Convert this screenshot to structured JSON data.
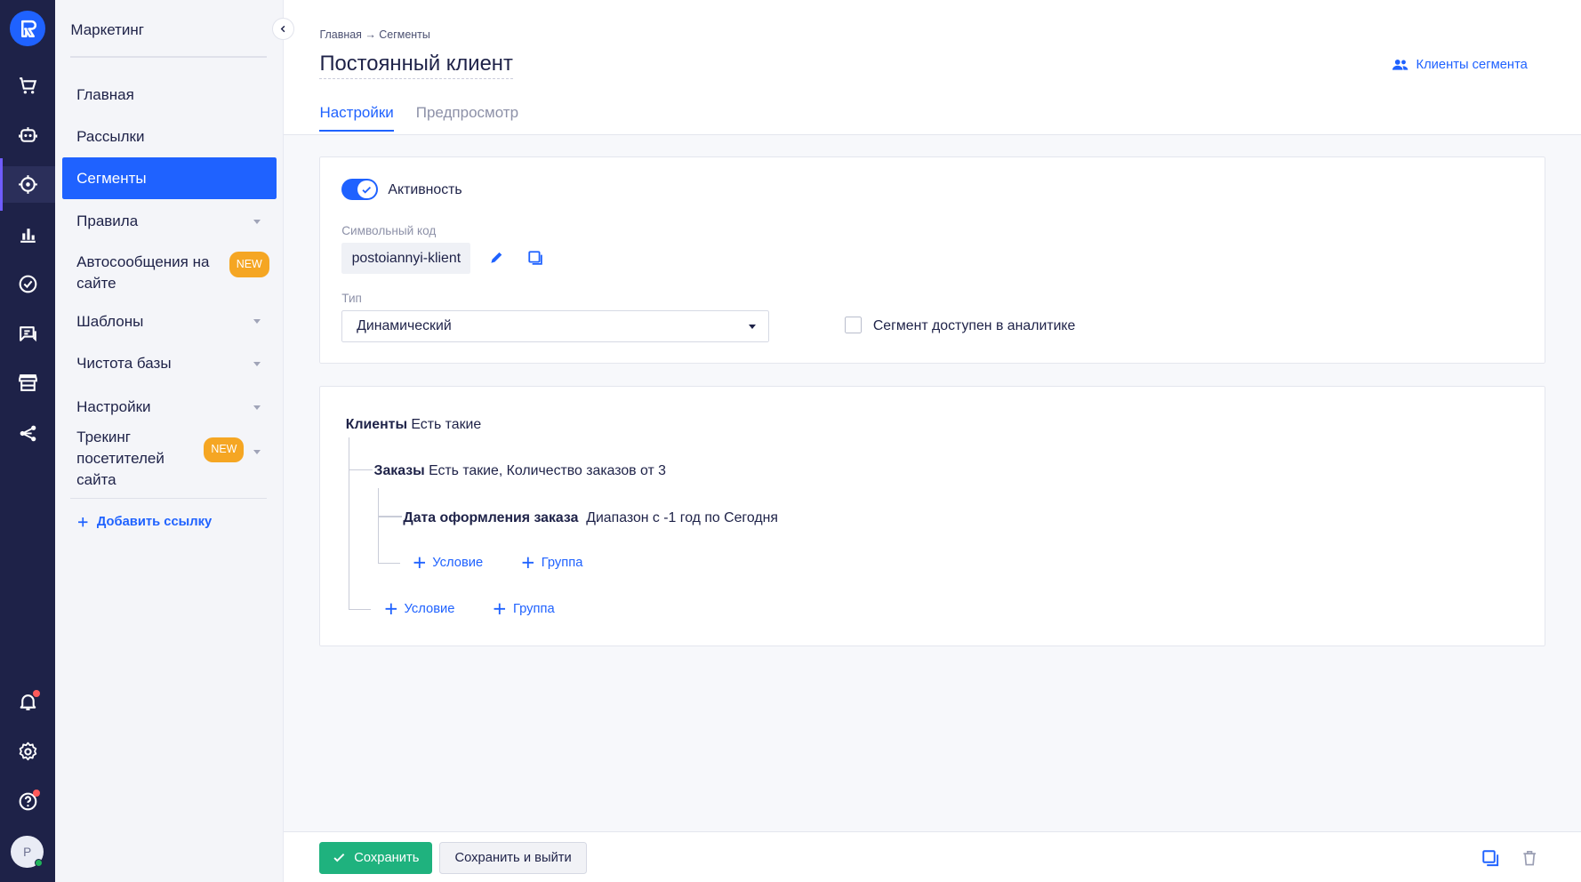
{
  "sidebar_menu": {
    "title": "Маркетинг",
    "items": [
      {
        "label": "Главная"
      },
      {
        "label": "Рассылки"
      },
      {
        "label": "Сегменты"
      },
      {
        "label": "Правила"
      },
      {
        "label": "Автосообщения на сайте",
        "badge": "NEW"
      },
      {
        "label": "Шаблоны"
      },
      {
        "label": "Чистота базы"
      },
      {
        "label": "Настройки"
      },
      {
        "label": "Трекинг посетителей сайта",
        "badge": "NEW"
      }
    ],
    "add_link": "Добавить ссылку"
  },
  "user": {
    "avatar_initial": "P"
  },
  "header": {
    "breadcrumb": "Главная → Сегменты",
    "title": "Постоянный клиент",
    "segment_clients_link": "Клиенты сегмента",
    "tabs": [
      {
        "label": "Настройки"
      },
      {
        "label": "Предпросмотр"
      }
    ]
  },
  "settings": {
    "activity_label": "Активность",
    "symbol_code_label": "Символьный код",
    "symbol_code_value": "postoiannyi-klient",
    "type_label": "Тип",
    "type_value": "Динамический",
    "analytics_label": "Сегмент доступен в аналитике"
  },
  "conditions": {
    "root": {
      "name": "Клиенты",
      "detail": "Есть такие"
    },
    "orders": {
      "name": "Заказы",
      "detail": "Есть такие, Количество заказов от 3"
    },
    "order_date": {
      "name": "Дата оформления заказа",
      "detail": "Диапазон с -1 год по Сегодня"
    },
    "add_condition": "Условие",
    "add_group": "Группа"
  },
  "footer": {
    "save": "Сохранить",
    "save_exit": "Сохранить и выйти"
  },
  "colors": {
    "primary": "#1f62ff",
    "rail": "#1e2248",
    "success": "#1fb27e",
    "badge": "#f5a623"
  }
}
